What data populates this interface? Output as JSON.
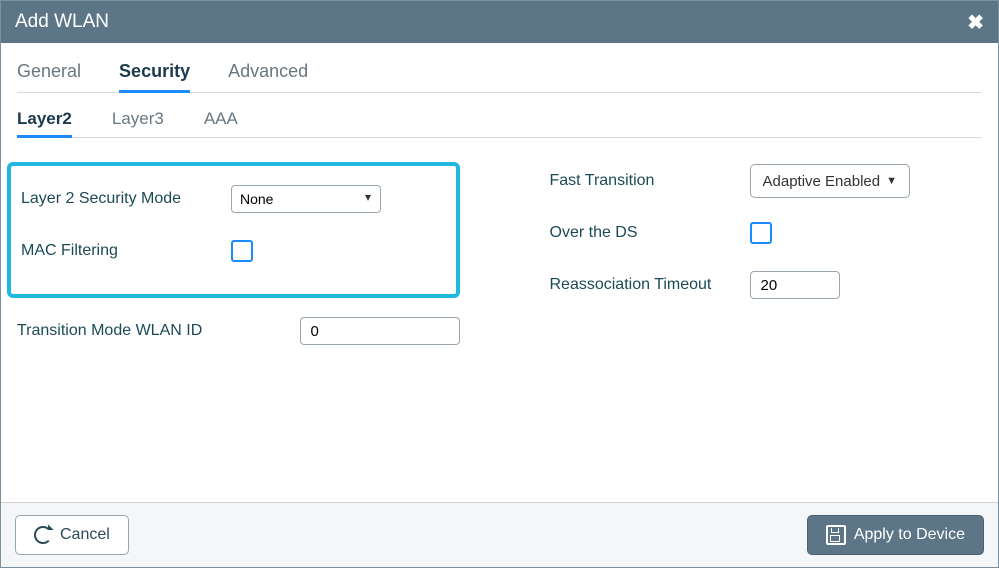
{
  "title": "Add WLAN",
  "tabs": {
    "general": "General",
    "security": "Security",
    "advanced": "Advanced",
    "active": "security"
  },
  "subtabs": {
    "layer2": "Layer2",
    "layer3": "Layer3",
    "aaa": "AAA",
    "active": "layer2"
  },
  "left": {
    "l2_security_mode_label": "Layer 2 Security Mode",
    "l2_security_mode_value": "None",
    "mac_filtering_label": "MAC Filtering",
    "mac_filtering_checked": false,
    "transition_mode_label": "Transition Mode WLAN ID",
    "transition_mode_value": "0"
  },
  "right": {
    "fast_transition_label": "Fast Transition",
    "fast_transition_value": "Adaptive Enabled",
    "over_ds_label": "Over the DS",
    "over_ds_checked": false,
    "reassoc_label": "Reassociation Timeout",
    "reassoc_value": "20"
  },
  "footer": {
    "cancel": "Cancel",
    "apply": "Apply to Device"
  }
}
